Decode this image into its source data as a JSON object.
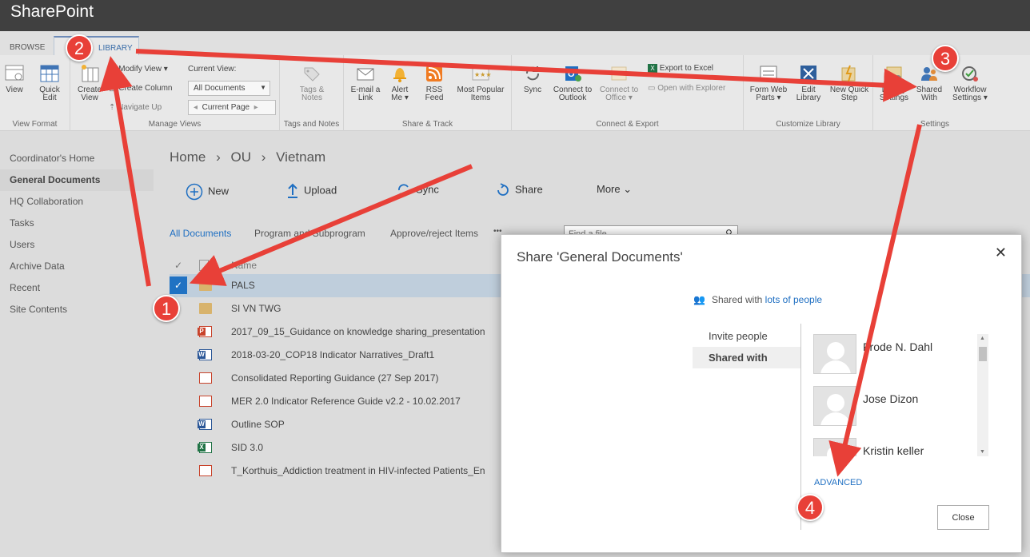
{
  "suite": {
    "brand": "SharePoint"
  },
  "ribbon_tabs": {
    "browse": "BROWSE",
    "library": "LIBRARY"
  },
  "ribbon": {
    "view_format": {
      "label": "View Format",
      "view": "View",
      "quick_edit_1": "Quick",
      "quick_edit_2": "Edit"
    },
    "manage_views": {
      "label": "Manage Views",
      "create_view_1": "Create",
      "create_view_2": "View",
      "modify_view": "Modify View",
      "create_column": "Create Column",
      "navigate_up": "Navigate Up",
      "current_view_label": "Current View:",
      "current_view_value": "All Documents",
      "current_page": "Current Page"
    },
    "tags_notes": {
      "label": "Tags and Notes",
      "btn_1": "Tags &",
      "btn_2": "Notes"
    },
    "share_track": {
      "label": "Share & Track",
      "email_1": "E-mail a",
      "email_2": "Link",
      "alert_1": "Alert",
      "alert_2": "Me",
      "rss_1": "RSS",
      "rss_2": "Feed",
      "popular_1": "Most Popular",
      "popular_2": "Items"
    },
    "connect_export": {
      "label": "Connect & Export",
      "sync": "Sync",
      "outlook_1": "Connect to",
      "outlook_2": "Outlook",
      "office_1": "Connect to",
      "office_2": "Office",
      "excel": "Export to Excel",
      "explorer": "Open with Explorer"
    },
    "customize": {
      "label": "Customize Library",
      "form_1": "Form Web",
      "form_2": "Parts",
      "edit_1": "Edit",
      "edit_2": "Library",
      "quickstep_1": "New Quick",
      "quickstep_2": "Step"
    },
    "settings": {
      "label": "Settings",
      "lib_1": "Library",
      "lib_2": "Settings",
      "shared_1": "Shared",
      "shared_2": "With",
      "wf_1": "Workflow",
      "wf_2": "Settings"
    }
  },
  "leftnav": [
    "Coordinator's Home",
    "General Documents",
    "HQ Collaboration",
    "Tasks",
    "Users",
    "Archive Data",
    "Recent",
    "Site Contents"
  ],
  "breadcrumb": [
    "Home",
    "OU",
    "Vietnam"
  ],
  "commands": {
    "new": "New",
    "upload": "Upload",
    "sync": "Sync",
    "share": "Share",
    "more": "More",
    "ellipsis": "•••"
  },
  "views": {
    "all": "All Documents",
    "program": "Program and Subprogram",
    "approve": "Approve/reject Items"
  },
  "search": {
    "placeholder": "Find a file"
  },
  "file_header": {
    "name": "Name"
  },
  "files": [
    {
      "name": "PALS",
      "type": "folder"
    },
    {
      "name": "SI VN TWG",
      "type": "folder"
    },
    {
      "name": "2017_09_15_Guidance on knowledge sharing_presentation",
      "type": "ppt"
    },
    {
      "name": "2018-03-20_COP18 Indicator Narratives_Draft1",
      "type": "word"
    },
    {
      "name": "Consolidated Reporting Guidance (27 Sep 2017)",
      "type": "pdf"
    },
    {
      "name": "MER 2.0 Indicator Reference Guide v2.2 - 10.02.2017",
      "type": "pdf"
    },
    {
      "name": "Outline SOP",
      "type": "word"
    },
    {
      "name": "SID 3.0",
      "type": "xls"
    },
    {
      "name": "T_Korthuis_Addiction treatment in HIV-infected Patients_En",
      "type": "pdf"
    }
  ],
  "dialog": {
    "title": "Share 'General Documents'",
    "shared_prefix": "Shared with ",
    "shared_link": "lots of people",
    "menu": [
      "Invite people",
      "Shared with"
    ],
    "people": [
      "Frode N. Dahl",
      "Jose Dizon",
      "Kristin keller"
    ],
    "advanced": "ADVANCED",
    "close": "Close"
  },
  "markers": [
    "1",
    "2",
    "3",
    "4"
  ],
  "colors": {
    "accent": "#1f6fc2",
    "annotation": "#e84038",
    "suitebar": "#404040"
  }
}
